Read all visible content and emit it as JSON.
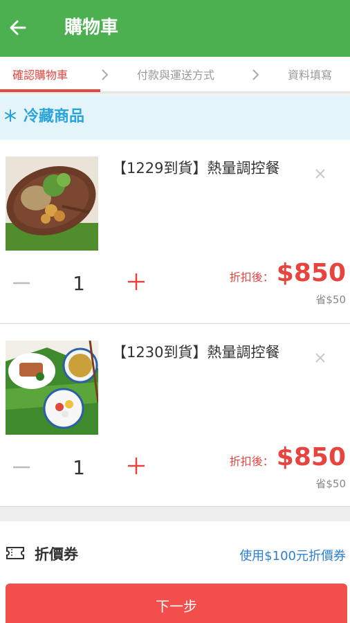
{
  "header": {
    "title": "購物車"
  },
  "steps": [
    {
      "label": "確認購物車"
    },
    {
      "label": "付款與運送方式"
    },
    {
      "label": "資料填寫"
    }
  ],
  "section": {
    "title": "冷藏商品",
    "icon": "snowflake-icon"
  },
  "items": [
    {
      "name": "【1229到貨】熱量調控餐",
      "qty": "1",
      "price_label": "折扣後：",
      "price": "$850",
      "save": "省$50"
    },
    {
      "name": "【1230到貨】熱量調控餐",
      "qty": "1",
      "price_label": "折扣後：",
      "price": "$850",
      "save": "省$50"
    }
  ],
  "coupon": {
    "title": "折價券",
    "link": "使用$100元折價券"
  },
  "footer": {
    "next": "下一步"
  },
  "colors": {
    "appbar": "#4caf50",
    "accent": "#e8443f",
    "section_bg": "#e3f4fb",
    "section_text": "#2aa4d8",
    "link": "#2b7fd1",
    "next_btn": "#f24f4c"
  }
}
